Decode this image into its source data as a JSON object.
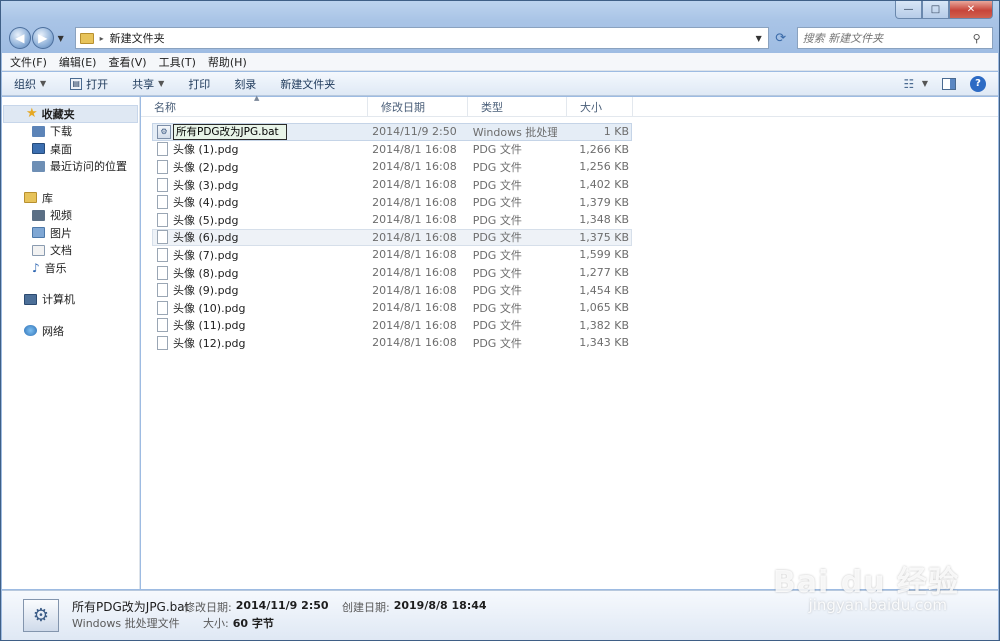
{
  "caption": {
    "minimize": "—",
    "maximize": "□",
    "close": "✕"
  },
  "address": {
    "back": "◀",
    "forward": "▶",
    "crumb_sep": "▸",
    "path": "新建文件夹",
    "search_placeholder": "搜索 新建文件夹"
  },
  "menu": [
    "文件(F)",
    "编辑(E)",
    "查看(V)",
    "工具(T)",
    "帮助(H)"
  ],
  "toolbar": {
    "organize": "组织",
    "open": "打开",
    "share": "共享",
    "print": "打印",
    "burn": "刻录",
    "new_folder": "新建文件夹",
    "help": "?"
  },
  "nav": {
    "favorites": "收藏夹",
    "favorites_items": [
      "下载",
      "桌面",
      "最近访问的位置"
    ],
    "libraries": "库",
    "library_items": [
      "视频",
      "图片",
      "文档",
      "音乐"
    ],
    "computer": "计算机",
    "network": "网络"
  },
  "columns": {
    "name": "名称",
    "date": "修改日期",
    "type": "类型",
    "size": "大小"
  },
  "files": [
    {
      "name": "所有PDG改为JPG.bat",
      "date": "2014/11/9 2:50",
      "type": "Windows 批处理...",
      "size": "1 KB"
    },
    {
      "name": "头像 (1).pdg",
      "date": "2014/8/1 16:08",
      "type": "PDG 文件",
      "size": "1,266 KB"
    },
    {
      "name": "头像 (2).pdg",
      "date": "2014/8/1 16:08",
      "type": "PDG 文件",
      "size": "1,256 KB"
    },
    {
      "name": "头像 (3).pdg",
      "date": "2014/8/1 16:08",
      "type": "PDG 文件",
      "size": "1,402 KB"
    },
    {
      "name": "头像 (4).pdg",
      "date": "2014/8/1 16:08",
      "type": "PDG 文件",
      "size": "1,379 KB"
    },
    {
      "name": "头像 (5).pdg",
      "date": "2014/8/1 16:08",
      "type": "PDG 文件",
      "size": "1,348 KB"
    },
    {
      "name": "头像 (6).pdg",
      "date": "2014/8/1 16:08",
      "type": "PDG 文件",
      "size": "1,375 KB"
    },
    {
      "name": "头像 (7).pdg",
      "date": "2014/8/1 16:08",
      "type": "PDG 文件",
      "size": "1,599 KB"
    },
    {
      "name": "头像 (8).pdg",
      "date": "2014/8/1 16:08",
      "type": "PDG 文件",
      "size": "1,277 KB"
    },
    {
      "name": "头像 (9).pdg",
      "date": "2014/8/1 16:08",
      "type": "PDG 文件",
      "size": "1,454 KB"
    },
    {
      "name": "头像 (10).pdg",
      "date": "2014/8/1 16:08",
      "type": "PDG 文件",
      "size": "1,065 KB"
    },
    {
      "name": "头像 (11).pdg",
      "date": "2014/8/1 16:08",
      "type": "PDG 文件",
      "size": "1,382 KB"
    },
    {
      "name": "头像 (12).pdg",
      "date": "2014/8/1 16:08",
      "type": "PDG 文件",
      "size": "1,343 KB"
    }
  ],
  "details": {
    "name": "所有PDG改为JPG.bat",
    "type": "Windows 批处理文件",
    "modified_label": "修改日期:",
    "modified": "2014/11/9 2:50",
    "created_label": "创建日期:",
    "created": "2019/8/8 18:44",
    "size_label": "大小:",
    "size": "60 字节"
  },
  "watermark": {
    "logo": "Bai du 经验",
    "url": "jingyan.baidu.com"
  }
}
